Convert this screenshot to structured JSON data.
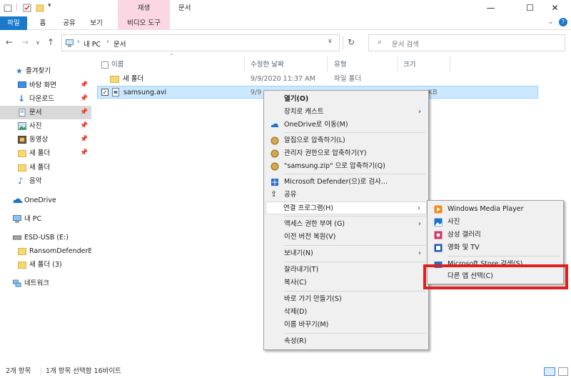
{
  "titlebar": {
    "context_tab_group": "재생",
    "window_title": "문서",
    "minimize": "—",
    "maximize": "☐",
    "close": "✕"
  },
  "ribbon": {
    "tabs": [
      "파일",
      "홈",
      "공유",
      "보기",
      "비디오 도구"
    ],
    "help": "?"
  },
  "address": {
    "path": [
      "내 PC",
      "문서"
    ],
    "search_placeholder": "문서 검색"
  },
  "sidebar": {
    "items": [
      {
        "label": "즐겨찾기",
        "icon": "star-icon"
      },
      {
        "label": "바탕 화면",
        "icon": "desktop-icon",
        "pinned": true
      },
      {
        "label": "다운로드",
        "icon": "download-icon",
        "pinned": true
      },
      {
        "label": "문서",
        "icon": "documents-icon",
        "pinned": true,
        "selected": true
      },
      {
        "label": "사진",
        "icon": "pictures-icon",
        "pinned": true
      },
      {
        "label": "동영상",
        "icon": "videos-icon",
        "pinned": true
      },
      {
        "label": "새 폴더",
        "icon": "folder-icon",
        "pinned": true
      },
      {
        "label": "새 폴더",
        "icon": "folder-icon"
      },
      {
        "label": "음악",
        "icon": "music-icon"
      },
      {
        "label": "OneDrive",
        "icon": "onedrive-icon"
      },
      {
        "label": "내 PC",
        "icon": "pc-icon"
      },
      {
        "label": "ESD-USB (E:)",
        "icon": "drive-icon"
      },
      {
        "label": "RansomDefenderBa",
        "icon": "folder-icon"
      },
      {
        "label": "새 폴더 (3)",
        "icon": "folder-icon"
      },
      {
        "label": "네트워크",
        "icon": "network-icon"
      }
    ]
  },
  "list": {
    "columns": [
      "이름",
      "수정한 날짜",
      "유형",
      "크기"
    ],
    "rows": [
      {
        "name": "새 폴더",
        "date": "9/9/2020 11:37 AM",
        "type": "파일 폴더",
        "size": ""
      },
      {
        "name": "samsung.avi",
        "date": "9/9",
        "type": "",
        "size": "KB"
      }
    ]
  },
  "status": {
    "count": "2개 항목",
    "selection": "1개 항목 선택함 16바이트"
  },
  "context_menu": {
    "items": [
      "열기(O)",
      "장치로 캐스트",
      "OneDrive로 이동(M)",
      "알집으로 압축하기(L)",
      "관리자 권한으로 압축하기(Y)",
      "\"samsung.zip\" 으로 압축하기(Q)",
      "Microsoft Defender(으)로 검사...",
      "공유",
      "연결 프로그램(H)",
      "액세스 권한 부여 (G)",
      "이전 버전 복원(V)",
      "보내기(N)",
      "잘라내기(T)",
      "복사(C)",
      "바로 가기 만들기(S)",
      "삭제(D)",
      "이름 바꾸기(M)",
      "속성(R)"
    ]
  },
  "submenu": {
    "items": [
      "Windows Media Player",
      "사진",
      "삼성 갤러리",
      "영화 및 TV",
      "Microsoft Store 검색(S)",
      "다른 앱 선택(C)"
    ]
  },
  "colors": {
    "accent": "#1979ca",
    "selection": "#cce8ff",
    "video_tools": "#fbd7e4",
    "annotation_box": "#e02020"
  }
}
